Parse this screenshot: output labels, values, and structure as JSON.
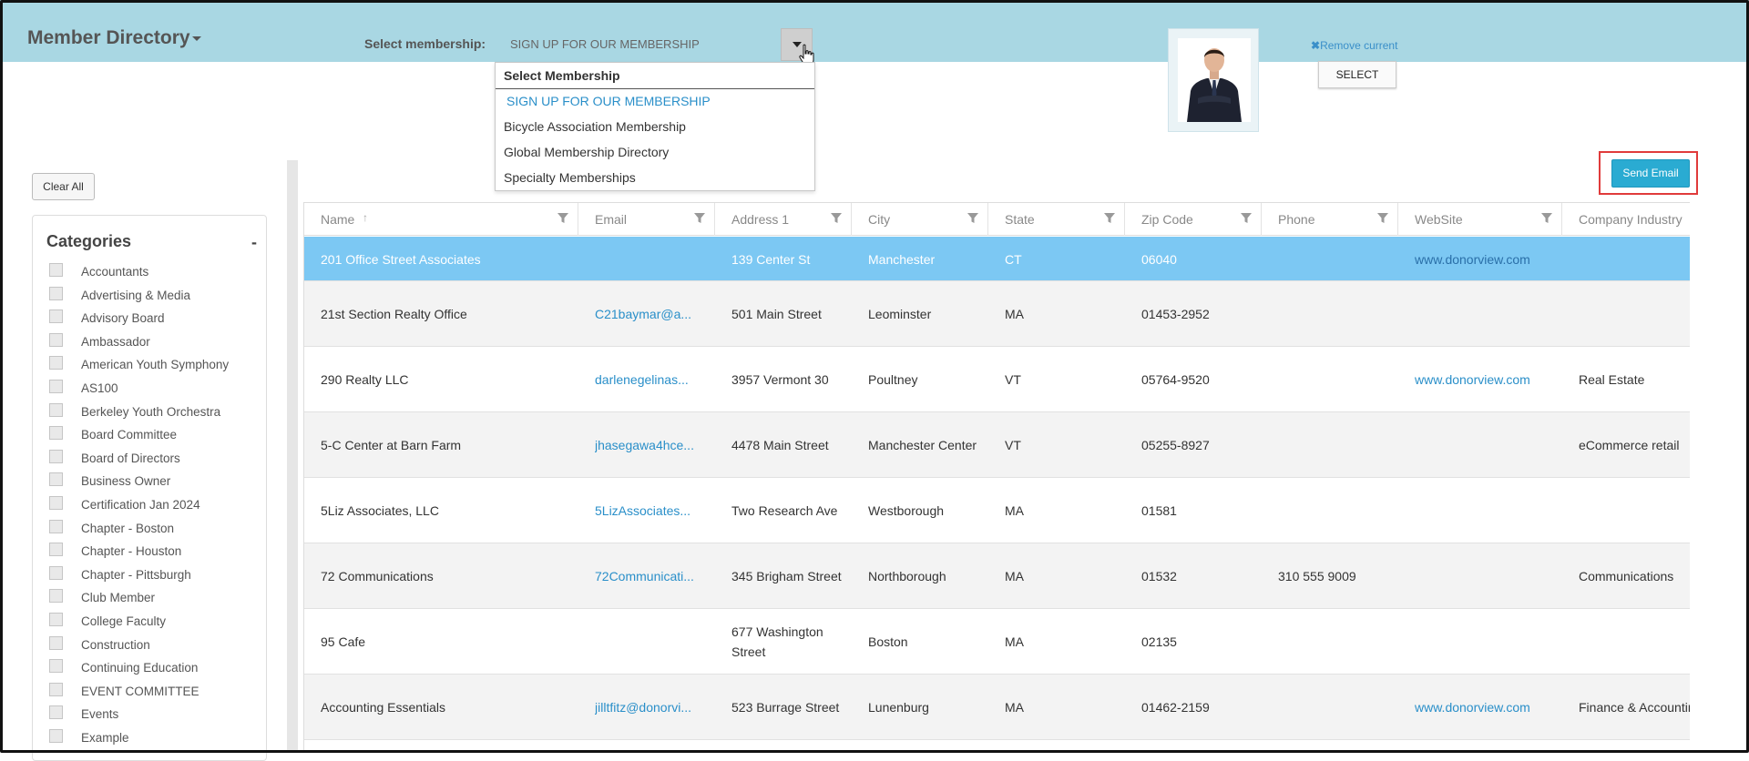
{
  "app": {
    "title": "Member Directory"
  },
  "membership": {
    "label": "Select membership:",
    "value": "SIGN UP FOR OUR MEMBERSHIP",
    "dropdown": {
      "header": "Select Membership",
      "options": [
        "SIGN UP FOR OUR MEMBERSHIP",
        "Bicycle Association Membership",
        "Global Membership Directory",
        "Specialty Memberships"
      ],
      "active_index": 0
    }
  },
  "profile": {
    "remove_label": "Remove current",
    "select_label": "SELECT"
  },
  "actions": {
    "send_email": "Send Email",
    "clear_all": "Clear All"
  },
  "categories": {
    "title": "Categories",
    "collapse_symbol": "-",
    "items": [
      "Accountants",
      "Advertising & Media",
      "Advisory Board",
      "Ambassador",
      "American Youth Symphony",
      "AS100",
      "Berkeley Youth Orchestra",
      "Board Committee",
      "Board of Directors",
      "Business Owner",
      "Certification Jan 2024",
      "Chapter - Boston",
      "Chapter - Houston",
      "Chapter - Pittsburgh",
      "Club Member",
      "College Faculty",
      "Construction",
      "Continuing Education",
      "EVENT COMMITTEE",
      "Events",
      "Example"
    ]
  },
  "table": {
    "columns": [
      "Name",
      "Email",
      "Address 1",
      "City",
      "State",
      "Zip Code",
      "Phone",
      "WebSite",
      "Company Industry"
    ],
    "sorted_column": "Name",
    "rows": [
      {
        "name": "201 Office Street Associates",
        "email": "",
        "address": "139 Center St",
        "city": "Manchester",
        "state": "CT",
        "zip": "06040",
        "phone": "",
        "website": "www.donorview.com",
        "industry": ""
      },
      {
        "name": "21st Section Realty Office",
        "email": "C21baymar@a...",
        "address": "501 Main Street",
        "city": "Leominster",
        "state": "MA",
        "zip": "01453-2952",
        "phone": "",
        "website": "",
        "industry": ""
      },
      {
        "name": "290 Realty LLC",
        "email": "darlenegelinas...",
        "address": "3957 Vermont 30",
        "city": "Poultney",
        "state": "VT",
        "zip": "05764-9520",
        "phone": "",
        "website": "www.donorview.com",
        "industry": "Real Estate"
      },
      {
        "name": "5-C Center at Barn Farm",
        "email": "jhasegawa4hce...",
        "address": "4478 Main Street",
        "city": "Manchester Center",
        "state": "VT",
        "zip": "05255-8927",
        "phone": "",
        "website": "",
        "industry": "eCommerce retail"
      },
      {
        "name": "5Liz Associates, LLC",
        "email": "5LizAssociates...",
        "address": "Two Research Ave",
        "city": "Westborough",
        "state": "MA",
        "zip": "01581",
        "phone": "",
        "website": "",
        "industry": ""
      },
      {
        "name": "72 Communications",
        "email": "72Communicati...",
        "address": "345 Brigham Street",
        "city": "Northborough",
        "state": "MA",
        "zip": "01532",
        "phone": "310 555 9009",
        "website": "",
        "industry": "Communications"
      },
      {
        "name": "95 Cafe",
        "email": "",
        "address": "677 Washington Street",
        "city": "Boston",
        "state": "MA",
        "zip": "02135",
        "phone": "",
        "website": "",
        "industry": ""
      },
      {
        "name": "Accounting Essentials",
        "email": "jilltfitz@donorvi...",
        "address": "523 Burrage Street",
        "city": "Lunenburg",
        "state": "MA",
        "zip": "01462-2159",
        "phone": "",
        "website": "www.donorview.com",
        "industry": "Finance & Accounting"
      }
    ]
  }
}
